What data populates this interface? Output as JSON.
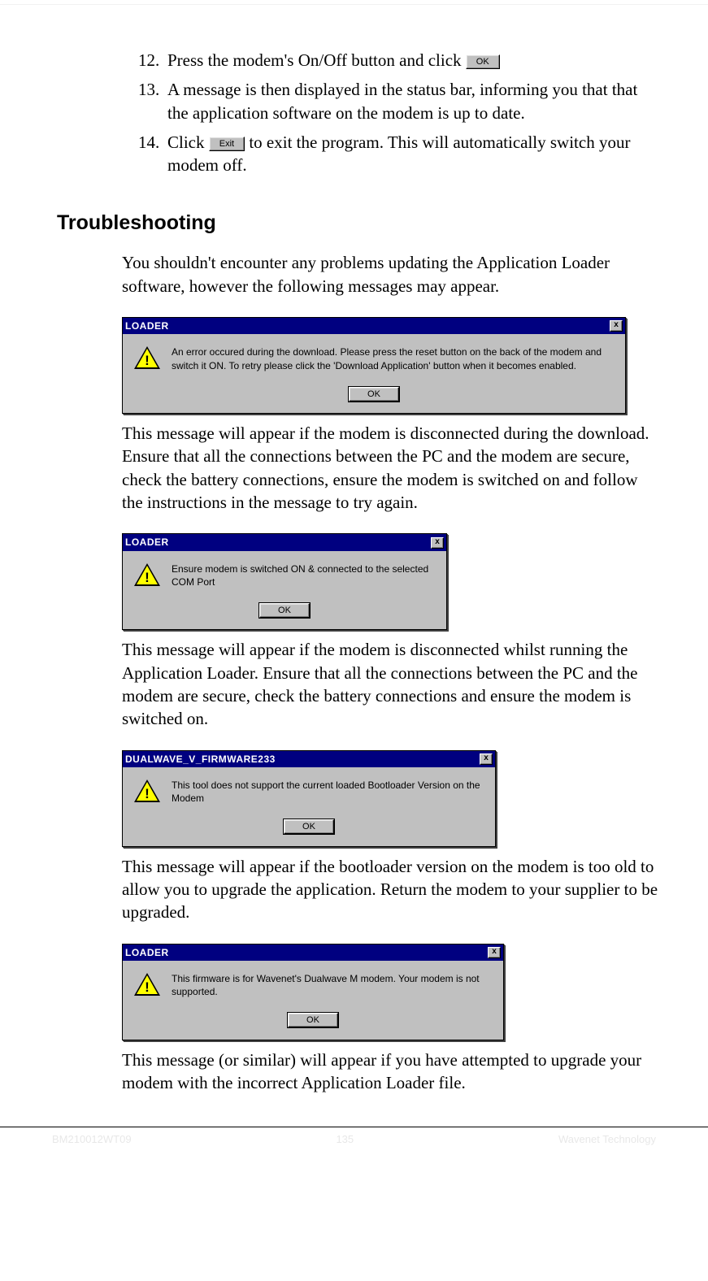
{
  "steps": {
    "s12": {
      "num": "12.",
      "pre": "Press the modem's On/Off button and click ",
      "btn": "OK"
    },
    "s13": {
      "num": "13.",
      "text": "A message is then displayed in the status bar, informing you that that the application software on the modem is up to date."
    },
    "s14": {
      "num": "14.",
      "pre": "Click ",
      "btn": "Exit",
      "post": " to exit the program. This will automatically switch your modem off."
    }
  },
  "heading": "Troubleshooting",
  "intro": "You shouldn't encounter any problems updating the Application Loader software, however the following messages may appear.",
  "dialogs": {
    "d1": {
      "title": "LOADER",
      "msg": "An error occured during the download. Please press the reset button on the back of the modem and switch it ON. To retry please click the 'Download Application' button when it becomes enabled.",
      "ok": "OK"
    },
    "d2": {
      "title": "LOADER",
      "msg": "Ensure modem is switched ON & connected to the selected COM Port",
      "ok": "OK"
    },
    "d3": {
      "title": "DUALWAVE_V_FIRMWARE233",
      "msg": "This tool does not support the current loaded Bootloader Version on the Modem",
      "ok": "OK"
    },
    "d4": {
      "title": "LOADER",
      "msg": "This firmware is for Wavenet's Dualwave M modem.  Your modem is not supported.",
      "ok": "OK"
    }
  },
  "explain": {
    "e1": "This message will appear if the modem is disconnected during the download. Ensure that all the connections between the PC and the modem are secure, check the battery connections, ensure the modem is switched on and follow the instructions in the message to try again.",
    "e2": "This message will appear if the modem is disconnected whilst running the Application Loader. Ensure that all the connections between the PC and the modem are secure, check the battery connections and ensure the modem is switched on.",
    "e3": "This message will appear if the bootloader version on the modem is too old to allow you to upgrade the application. Return the modem to your supplier to be upgraded.",
    "e4": "This message (or similar) will appear if you have attempted to upgrade your modem with the incorrect Application Loader file."
  },
  "footer": {
    "left": "BM210012WT09",
    "mid": "135",
    "right": "Wavenet Technology"
  },
  "close_x": "x"
}
